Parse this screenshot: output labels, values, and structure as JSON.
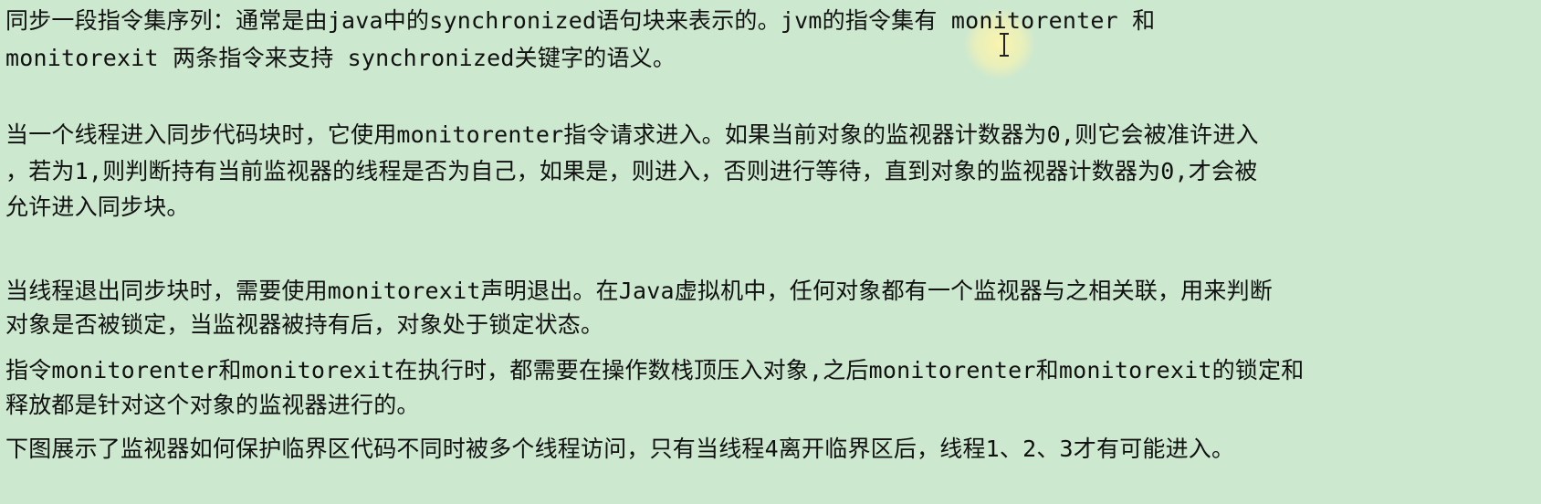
{
  "document": {
    "lines": [
      "同步一段指令集序列：通常是由java中的synchronized语句块来表示的。jvm的指令集有 monitorenter 和",
      "monitorexit 两条指令来支持 synchronized关键字的语义。",
      "当一个线程进入同步代码块时，它使用monitorenter指令请求进入。如果当前对象的监视器计数器为0,则它会被准许进入",
      "，若为1,则判断持有当前监视器的线程是否为自己，如果是，则进入，否则进行等待，直到对象的监视器计数器为0,才会被",
      "允许进入同步块。",
      "当线程退出同步块时，需要使用monitorexit声明退出。在Java虚拟机中，任何对象都有一个监视器与之相关联，用来判断",
      "对象是否被锁定，当监视器被持有后，对象处于锁定状态。",
      "指令monitorenter和monitorexit在执行时，都需要在操作数栈顶压入对象,之后monitorenter和monitorexit的锁定和",
      "释放都是针对这个对象的监视器进行的。",
      "下图展示了监视器如何保护临界区代码不同时被多个线程访问，只有当线程4离开临界区后，线程1、2、3才有可能进入。"
    ]
  },
  "colors": {
    "background": "#cce8cf",
    "text": "#111111",
    "cursor_highlight": "#fff5aa"
  },
  "icons": {
    "cursor": "text-cursor-icon"
  }
}
